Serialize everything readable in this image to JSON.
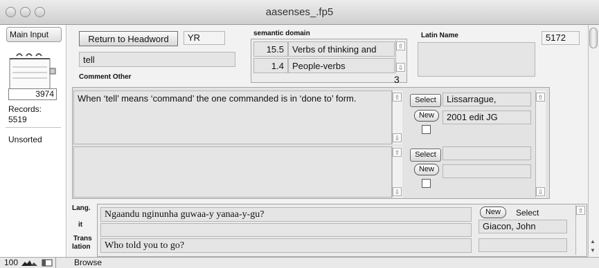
{
  "window": {
    "title": "aasenses_.fp5"
  },
  "status_area": {
    "layout_menu": "Main Input",
    "current_record": "3974",
    "records_label": "Records:",
    "records_count": "5519",
    "sort_status": "Unsorted"
  },
  "header": {
    "return_button": "Return to Headword",
    "code": "YR",
    "headword": "tell",
    "semantic_domain_label": "semantic domain",
    "domains": [
      {
        "num": "15.5",
        "label": "Verbs of thinking and"
      },
      {
        "num": "1.4",
        "label": "People-verbs"
      }
    ],
    "domain_count": "3",
    "latin_name_label": "Latin Name",
    "latin_name_value": "",
    "record_id": "5172",
    "comment_other_label": "Comment Other"
  },
  "comments": [
    {
      "text": "When ‘tell’ means ‘command’ the one commanded is in ‘done to’ form.",
      "select_label": "Select",
      "new_label": "New",
      "source": "Lissarrague,",
      "edit": "2001 edit JG"
    },
    {
      "text": "",
      "select_label": "Select",
      "new_label": "New",
      "source": "",
      "edit": ""
    }
  ],
  "example": {
    "lang_label": "Lang.",
    "it_label": "it",
    "trans_label": "Trans",
    "lation_label": "lation",
    "sentence": "Ngaandu nginunha guwaa-y yanaa-y-gu?",
    "literal": "",
    "translation": "Who told you to go?",
    "new_label": "New",
    "select_label": "Select",
    "source": "Giacon, John",
    "source2": ""
  },
  "bottom": {
    "zoom": "100",
    "mode": "Browse"
  }
}
